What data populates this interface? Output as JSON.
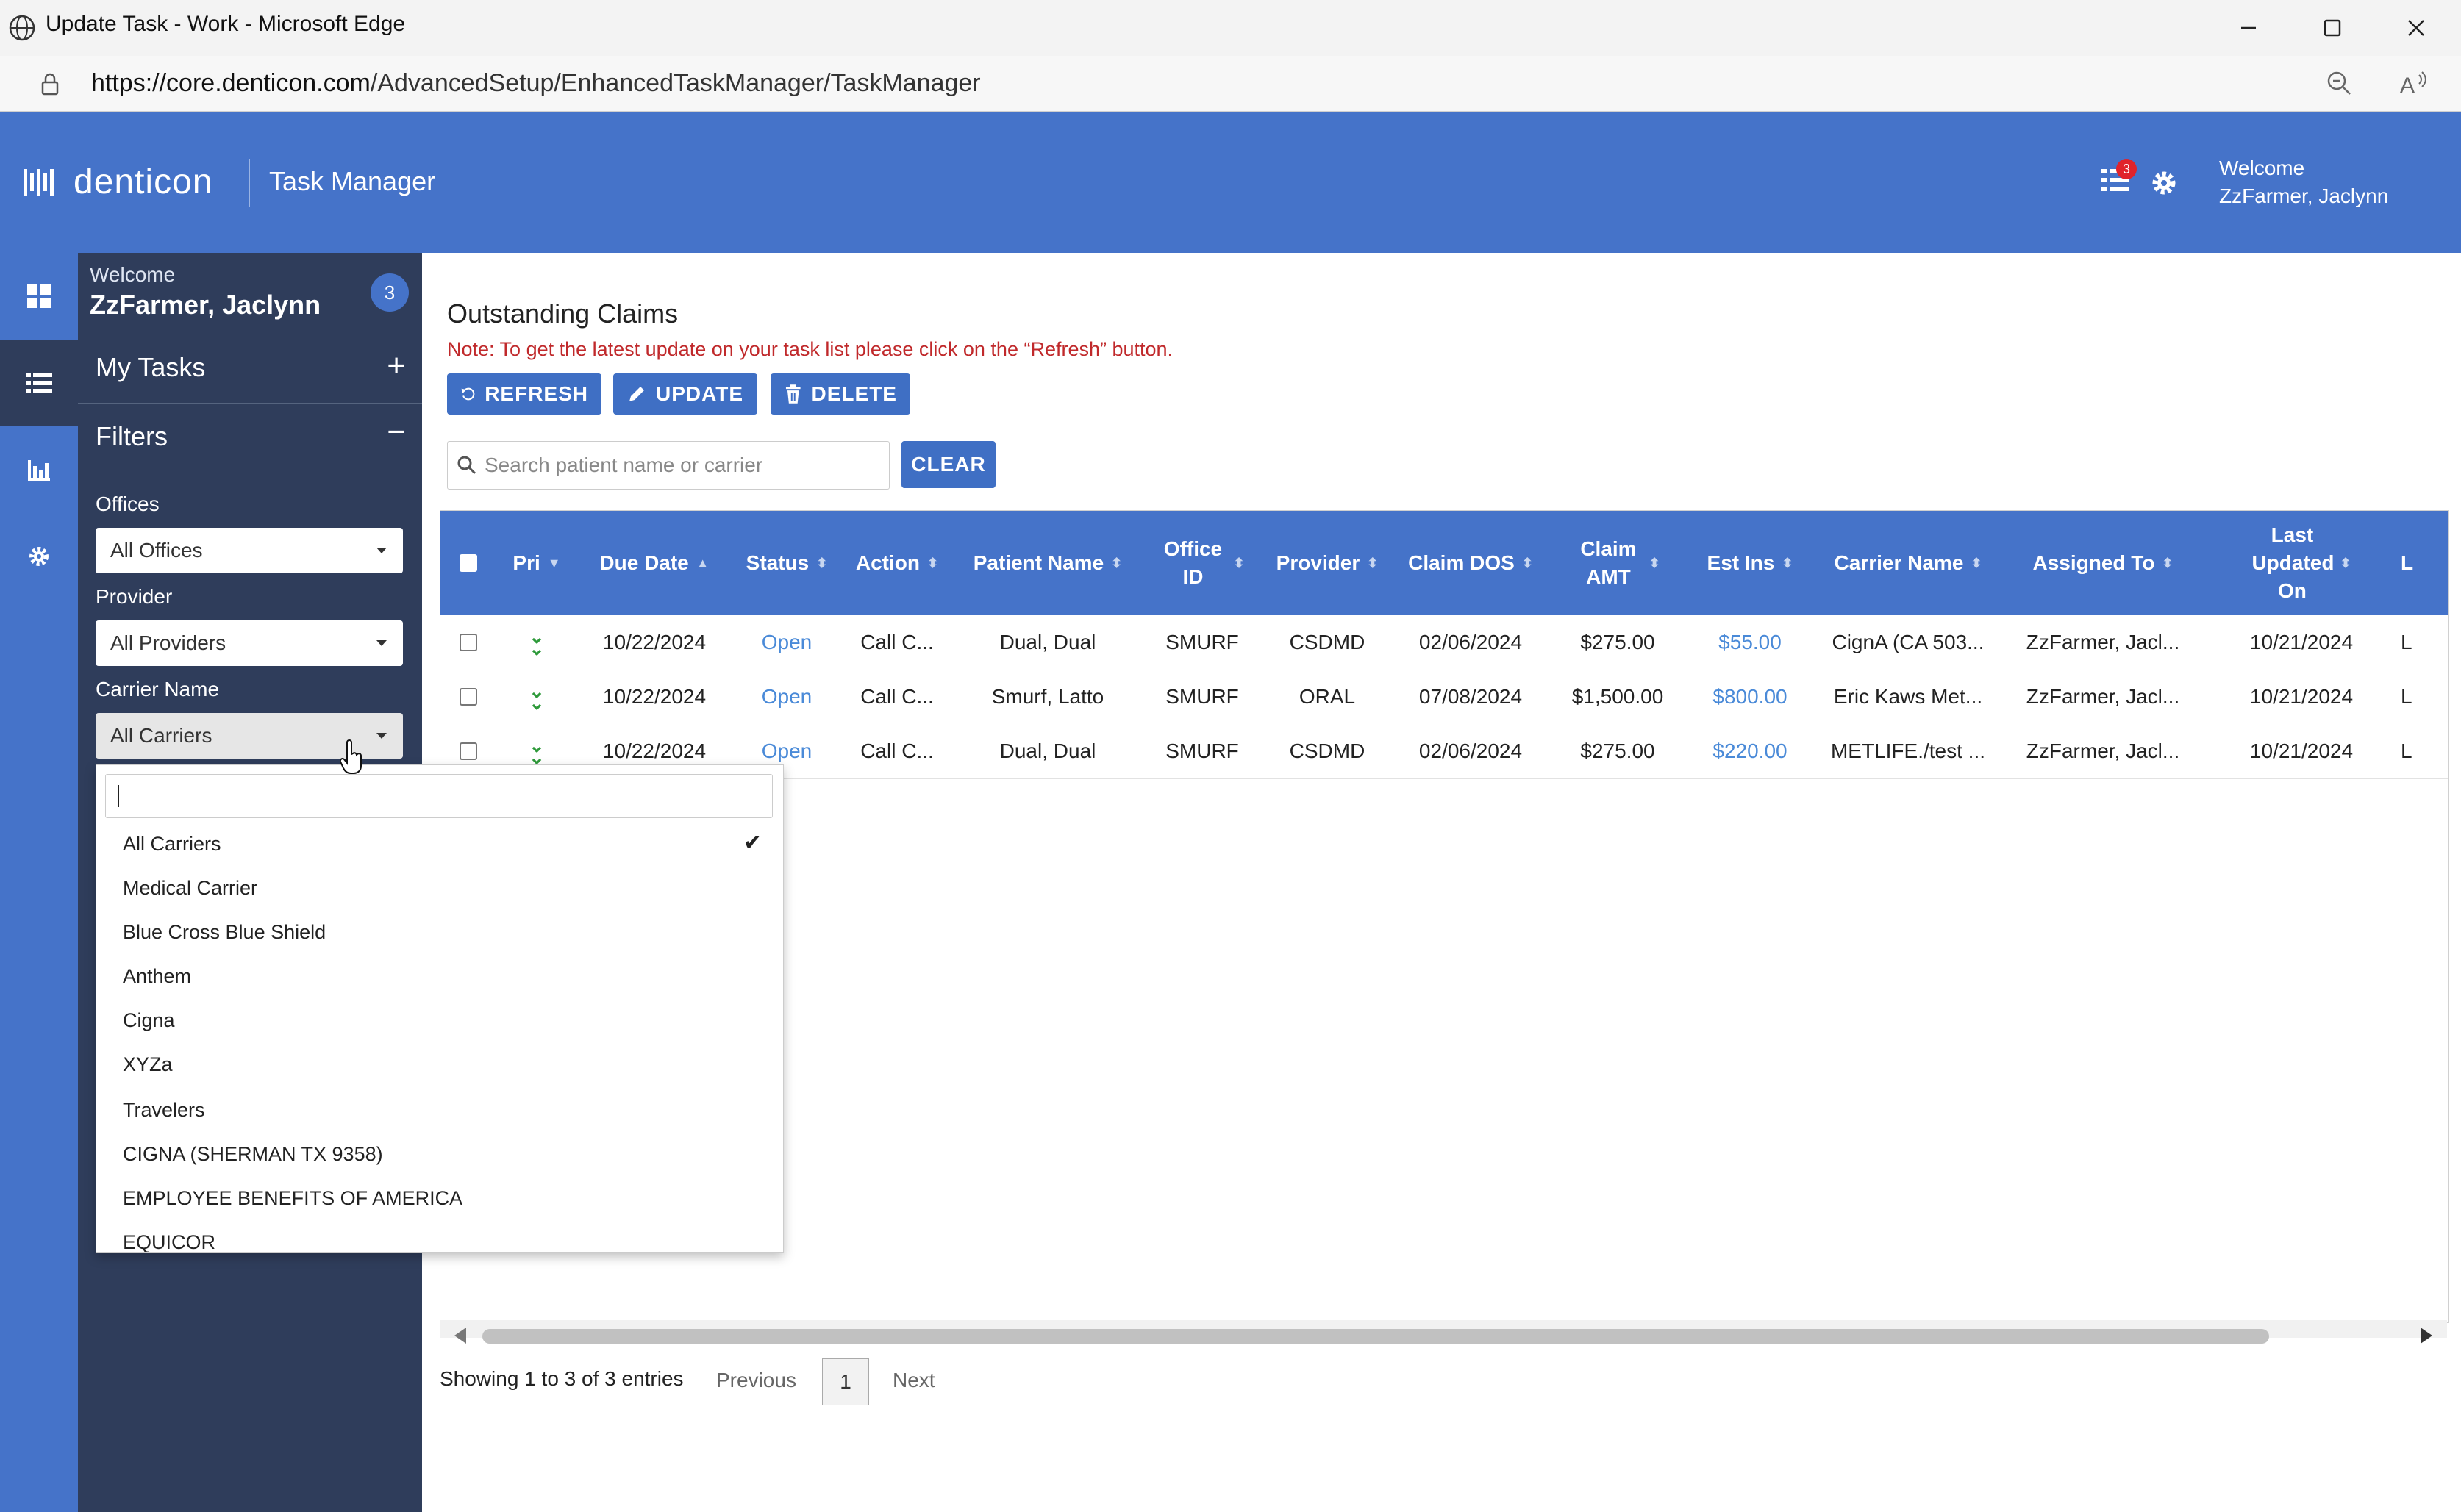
{
  "window": {
    "title": "Update Task - Work - Microsoft Edge",
    "url_host": "https://core.denticon.com",
    "url_path": "/AdvancedSetup/EnhancedTaskManager/TaskManager"
  },
  "header": {
    "logo": "denticon",
    "app_title": "Task Manager",
    "notif_count": "3",
    "welcome": "Welcome",
    "user": "ZzFarmer, Jaclynn"
  },
  "sidebar": {
    "welcome": "Welcome",
    "user": "ZzFarmer, Jaclynn",
    "badge": "3",
    "my_tasks": "My Tasks",
    "filters": "Filters",
    "offices_label": "Offices",
    "offices_value": "All Offices",
    "provider_label": "Provider",
    "provider_value": "All Providers",
    "carrier_label": "Carrier Name",
    "carrier_value": "All Carriers"
  },
  "main": {
    "title": "Outstanding Claims",
    "note": "Note: To get the latest update on your task list please click on the “Refresh” button.",
    "refresh": "REFRESH",
    "update": "UPDATE",
    "delete": "DELETE",
    "search_placeholder": "Search patient name or carrier",
    "clear": "CLEAR"
  },
  "table": {
    "headers": {
      "pri": "Pri",
      "due_date": "Due Date",
      "status": "Status",
      "action": "Action",
      "patient": "Patient Name",
      "office_id": "Office ID",
      "provider": "Provider",
      "claim_dos": "Claim DOS",
      "claim_amt": "Claim AMT",
      "est_ins": "Est Ins",
      "carrier": "Carrier Name",
      "assigned": "Assigned To",
      "last_updated": "Last Updated On",
      "l": "L"
    },
    "rows": [
      {
        "due": "10/22/2024",
        "status": "Open",
        "action": "Call C...",
        "patient": "Dual, Dual",
        "office": "SMURF",
        "provider": "CSDMD",
        "dos": "02/06/2024",
        "amt": "$275.00",
        "est": "$55.00",
        "carrier": "CignA (CA 503...",
        "assigned": "ZzFarmer, Jacl...",
        "updated": "10/21/2024",
        "l": "L"
      },
      {
        "due": "10/22/2024",
        "status": "Open",
        "action": "Call C...",
        "patient": "Smurf, Latto",
        "office": "SMURF",
        "provider": "ORAL",
        "dos": "07/08/2024",
        "amt": "$1,500.00",
        "est": "$800.00",
        "carrier": "Eric Kaws Met...",
        "assigned": "ZzFarmer, Jacl...",
        "updated": "10/21/2024",
        "l": "L"
      },
      {
        "due": "10/22/2024",
        "status": "Open",
        "action": "Call C...",
        "patient": "Dual, Dual",
        "office": "SMURF",
        "provider": "CSDMD",
        "dos": "02/06/2024",
        "amt": "$275.00",
        "est": "$220.00",
        "carrier": "METLIFE./test ...",
        "assigned": "ZzFarmer, Jacl...",
        "updated": "10/21/2024",
        "l": "L"
      }
    ],
    "showing": "Showing 1 to 3 of 3 entries",
    "previous": "Previous",
    "page": "1",
    "next": "Next"
  },
  "dropdown": {
    "items": [
      "All Carriers",
      "Medical Carrier",
      "Blue Cross Blue Shield",
      "Anthem",
      "Cigna",
      "XYZa",
      "Travelers",
      "CIGNA (SHERMAN TX 9358)",
      "EMPLOYEE BENEFITS OF AMERICA",
      "EQUICOR"
    ],
    "selected": "All Carriers"
  },
  "colors": {
    "brand": "#4573c9",
    "sidebar": "#2f3d5b",
    "note_red": "#c0292b",
    "link": "#4a8ad8"
  }
}
